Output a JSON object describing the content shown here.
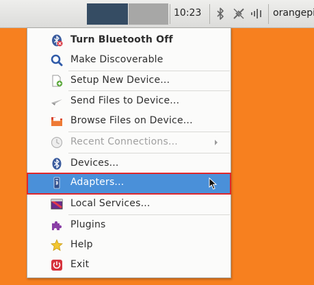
{
  "panel": {
    "clock": "10:23",
    "user": "orangepi",
    "tray_icons": [
      "bluetooth-icon",
      "network-disconnected-icon",
      "volume-icon"
    ]
  },
  "menu": {
    "items": [
      {
        "label": "Turn Bluetooth Off",
        "icon": "bluetooth-icon",
        "bold": true
      },
      {
        "label": "Make Discoverable",
        "icon": "search-icon"
      },
      {
        "label": "Setup New Device...",
        "icon": "document-add-icon"
      },
      {
        "label": "Send Files to Device...",
        "icon": "send-icon"
      },
      {
        "label": "Browse Files on Device...",
        "icon": "folder-icon"
      },
      {
        "label": "Recent Connections...",
        "icon": "recent-icon",
        "disabled": true,
        "submenu": true
      },
      {
        "label": "Devices...",
        "icon": "bluetooth-icon"
      },
      {
        "label": "Adapters...",
        "icon": "adapter-icon",
        "selected": true
      },
      {
        "label": "Local Services...",
        "icon": "services-icon"
      },
      {
        "label": "Plugins",
        "icon": "puzzle-icon"
      },
      {
        "label": "Help",
        "icon": "star-icon"
      },
      {
        "label": "Exit",
        "icon": "power-icon"
      }
    ]
  },
  "colors": {
    "desktop": "#f7801f",
    "selection": "#4a90d9",
    "highlight_border": "#e0262a"
  }
}
